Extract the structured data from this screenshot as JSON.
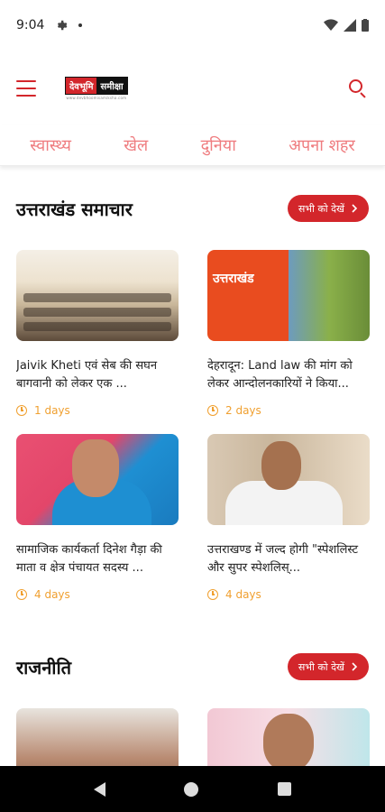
{
  "status_bar": {
    "time": "9:04"
  },
  "header": {
    "logo_part1": "देवभूमि",
    "logo_part2": "समीक्षा",
    "logo_sub": "www.devbhoomisamiksha.com"
  },
  "tabs": [
    "स्वास्थ्य",
    "खेल",
    "दुनिया",
    "अपना शहर"
  ],
  "sections": [
    {
      "title": "उत्तराखंड समाचार",
      "see_all": "सभी को देखें",
      "cards": [
        {
          "headline": "Jaivik Kheti एवं सेब की सघन बागवानी को लेकर एक ...",
          "time": "1 days",
          "image": "meeting-hall-photo"
        },
        {
          "headline": "देहरादून: Land law की मांग को लेकर आन्दोलनकारियों ने किया...",
          "time": "2 days",
          "image": "uttarakhand-map-photo",
          "image_text": "उत्तराखंड"
        },
        {
          "headline": "सामाजिक कार्यकर्ता दिनेश गैड़ा की माता व क्षेत्र पंचायत सदस्य ...",
          "time": "4 days",
          "image": "elderly-woman-photo"
        },
        {
          "headline": "उत्तराखण्ड में जल्द होगी \"स्पेशलिस्ट और सुपर स्पेशलिस्...",
          "time": "4 days",
          "image": "official-with-mask-photo"
        }
      ]
    },
    {
      "title": "राजनीति",
      "see_all": "सभी को देखें",
      "cards": [
        {
          "image": "crowd-photo"
        },
        {
          "image": "politician-photo"
        }
      ]
    }
  ],
  "colors": {
    "brand_red": "#d3262b",
    "tab_text": "#ef7d80",
    "time_orange": "#f0a030"
  },
  "icons": [
    "settings-icon",
    "wifi-icon",
    "signal-icon",
    "battery-icon",
    "menu-icon",
    "search-icon",
    "chevron-right-icon",
    "clock-icon",
    "nav-back-icon",
    "nav-home-icon",
    "nav-recent-icon"
  ]
}
